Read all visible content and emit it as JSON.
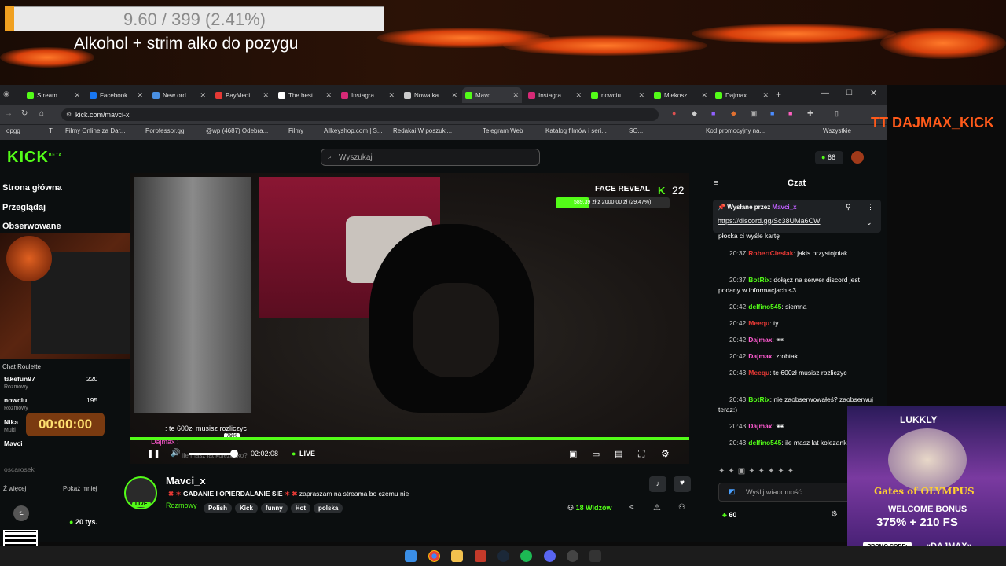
{
  "overlay": {
    "goal_text": "9.60 / 399 (2.41%)",
    "goal_progress": 0.0241,
    "goal_title": "Alkohol + strim alko do pozygu",
    "tiktok_handle": "TT DAJMAX_KICK"
  },
  "browser": {
    "tabs": [
      {
        "label": "Stream",
        "color": "#53fc18"
      },
      {
        "label": "Facebook",
        "color": "#1877f2"
      },
      {
        "label": "New ord",
        "color": "#4a90e2"
      },
      {
        "label": "PayMedi",
        "color": "#e53935"
      },
      {
        "label": "The best",
        "color": "#ffffff"
      },
      {
        "label": "Instagra",
        "color": "#d62976"
      },
      {
        "label": "Nowa ka",
        "color": "#cccccc"
      },
      {
        "label": "Mavc",
        "color": "#53fc18"
      },
      {
        "label": "Instagra",
        "color": "#d62976"
      },
      {
        "label": "nowciu",
        "color": "#53fc18"
      },
      {
        "label": "Mlekosz",
        "color": "#53fc18"
      },
      {
        "label": "Dajmax",
        "color": "#53fc18"
      }
    ],
    "url": "kick.com/mavci-x",
    "bookmarks": [
      "opgg",
      "T",
      "Filmy Online za Dar...",
      "Porofessor.gg",
      "@wp (4687) Odebra...",
      "Filmy",
      "Allkeyshop.com | S...",
      "Redakai W poszuki...",
      "Telegram Web",
      "Katalog filmów i seri...",
      "SO...",
      "Kod promocyjny na...",
      "Wszystkie"
    ]
  },
  "kick": {
    "logo": "KICK",
    "logo_beta": "BETA",
    "search_placeholder": "Wyszukaj",
    "coins": "66",
    "nav": [
      "Strona główna",
      "Przeglądaj",
      "Obserwowane"
    ],
    "chat_roulette_label": "Chat Roulette",
    "following": [
      {
        "name": "takefun97",
        "sub": "Rozmowy",
        "count": "220"
      },
      {
        "name": "nowciu",
        "sub": "Rozmowy",
        "count": "195"
      },
      {
        "name": "Nika",
        "sub": "Multi",
        "count": ""
      },
      {
        "name": "Mavci",
        "sub": "",
        "count": ""
      },
      {
        "name": "oscarosek",
        "sub": "",
        "count": ""
      }
    ],
    "show_more": "Ż więcej",
    "show_less": "Pokaż mniej",
    "viewers_small": "20 tys.",
    "timer": "00:00:00",
    "player": {
      "face_reveal_label": "FACE REVEAL",
      "face_reveal_count": "22",
      "face_reveal_progress_text": "589,39 zł z 2000,00 zł (29.47%)",
      "face_reveal_progress": 0.2947,
      "overlay_chat_line": ": te 600zł musisz rozliczyc",
      "overlay_chat_user": "Dajmax :",
      "overlay_chat_line2": "ile masz lat kolezanko?",
      "volume_tooltip": "79%",
      "elapsed": "02:02:08",
      "live": "LIVE"
    },
    "stream": {
      "streamer": "Mavci_x",
      "live_badge": "LIVE",
      "title": "GADANIE I OPIERDALANIE SIE",
      "title_suffix": "zapraszam na streama bo czemu nie",
      "category": "Rozmowy",
      "tags": [
        "Polish",
        "Kick",
        "funny",
        "Hot",
        "polska"
      ],
      "viewers": "18 Widzów"
    },
    "chat": {
      "title": "Czat",
      "pinned_by_label": "Wysłane przez",
      "pinned_by_user": "Mavci_x",
      "pinned_link": "https://discord.gg/Sc38UMa6CW",
      "fragment": "płocka ci wyśle kartę",
      "messages": [
        {
          "time": "20:37",
          "user": "RobertCieslak",
          "user_color": "#e53935",
          "text": "jakis przystojniak"
        },
        {
          "time": "20:37",
          "user": "BotRix",
          "user_color": "#53fc18",
          "text": "dołącz na serwer discord jest podany w informacjach <3"
        },
        {
          "time": "20:42",
          "user": "delfino545",
          "user_color": "#53fc18",
          "text": "siemna"
        },
        {
          "time": "20:42",
          "user": "Meequ",
          "user_color": "#e53935",
          "text": "ty"
        },
        {
          "time": "20:42",
          "user": "Dajmax",
          "user_color": "#ff5ad1",
          "text": "🕶"
        },
        {
          "time": "20:42",
          "user": "Dajmax",
          "user_color": "#ff5ad1",
          "text": "zrobtak"
        },
        {
          "time": "20:43",
          "user": "Meequ",
          "user_color": "#e53935",
          "text": "te 600zł musisz rozliczyc"
        },
        {
          "time": "20:43",
          "user": "BotRix",
          "user_color": "#53fc18",
          "text": "nie zaobserwowałeś? zaobserwuj teraz:)"
        },
        {
          "time": "20:43",
          "user": "Dajmax",
          "user_color": "#ff5ad1",
          "text": "🕶"
        },
        {
          "time": "20:43",
          "user": "delfino545",
          "user_color": "#53fc18",
          "text": "ile masz lat kolezanko?"
        }
      ],
      "input_placeholder": "Wyślij wiadomość",
      "points": "60"
    }
  },
  "ad": {
    "brand": "LUKKLY",
    "game": "Gates of OLYMPUS",
    "headline": "WELCOME BONUS",
    "offer": "375% + 210 FS",
    "promo_label": "PROMO CODE:",
    "promo_code": "«DAJMAX»"
  }
}
